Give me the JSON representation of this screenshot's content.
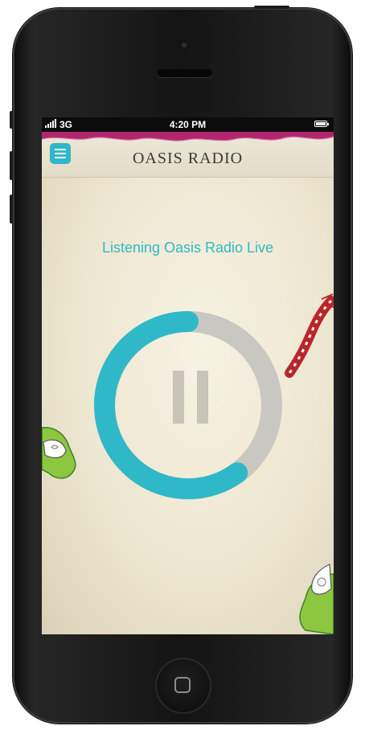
{
  "status_bar": {
    "network": "3G",
    "time": "4:20 PM",
    "icons": [
      "signal-icon",
      "battery-icon"
    ]
  },
  "header": {
    "title": "OASIS RADIO",
    "menu_icon": "hamburger-menu-icon"
  },
  "player": {
    "status_text": "Listening Oasis Radio Live",
    "control_icon": "pause-icon",
    "progress_fraction": 0.6
  },
  "colors": {
    "accent": "#2fb9c8",
    "track": "#c9c7c1",
    "background": "#f2eedc"
  }
}
